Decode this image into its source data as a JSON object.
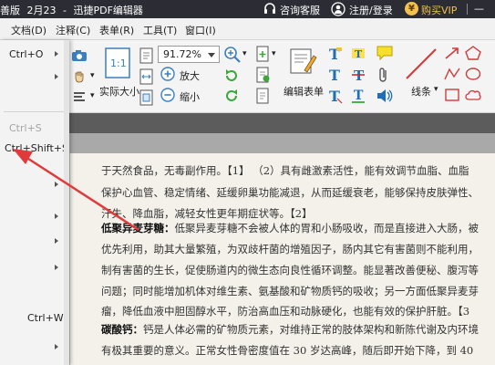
{
  "window": {
    "title_prefix": "善版",
    "date": "2月23",
    "app_name": "迅捷PDF编辑器",
    "support": "咨询客服",
    "login": "注册/登录",
    "vip": "购买VIP",
    "vip_icon": "¥",
    "minimize": "—"
  },
  "menubar": [
    "文档(D)",
    "注释(C)",
    "表单(R)",
    "工具(T)",
    "窗口(I)"
  ],
  "dropdown": {
    "items": [
      {
        "label": "Ctrl+O",
        "arrow": true,
        "disabled": false
      },
      {
        "label": "",
        "arrow": true,
        "disabled": false
      },
      {
        "label": "Ctrl+S",
        "arrow": false,
        "disabled": true
      },
      {
        "label": "Ctrl+Shift+S",
        "arrow": false,
        "disabled": false
      },
      {
        "label": "Ctrl+W",
        "arrow": false,
        "disabled": false
      }
    ]
  },
  "ribbon": {
    "zoom_value": "91.72%",
    "actual_size": "实际大小",
    "zoom_in": "放大",
    "zoom_out": "缩小",
    "edit_form": "编辑表单",
    "lines": "线条"
  },
  "document": {
    "lines": [
      {
        "bold": "",
        "text": "于天然食品，无毒副作用。【1】  （2）具有雌激素活性，能有效调节血脂、血脂"
      },
      {
        "bold": "",
        "text": "保护心血管、稳定情绪、延缓卵巢功能减退，从而延缓衰老，能够保持皮肤弹性、"
      },
      {
        "bold": "",
        "text": "汗失、降血脂，减轻女性更年期症状等。【2】"
      },
      {
        "bold": "低聚异麦芽糖：",
        "text": "低聚异麦芽糖不会被人体的胃和小肠吸收，而是直接进入大肠，被"
      },
      {
        "bold": "",
        "text": "优先利用，助其大量繁殖，为双歧杆菌的增殖因子，肠内其它有害菌则不能利用，"
      },
      {
        "bold": "",
        "text": "制有害菌的生长，促使肠道内的微生态向良性循环调整。能显著改善便秘、腹泻等"
      },
      {
        "bold": "",
        "text": "问题；同时能增加机体对维生素、氨基酸和矿物质钙的吸收；另一方面低聚异麦芽"
      },
      {
        "bold": "",
        "text": "瘤，降低血液中胆固醇水平，防治高血压和动脉硬化，也能有效的保护肝脏。【3"
      },
      {
        "bold": "碳酸钙：",
        "text": "钙是人体必需的矿物质元素，对维持正常的肢体架构和新陈代谢及内环境"
      },
      {
        "bold": "",
        "text": "有极其重要的意义。正常女性骨密度值在 30 岁达高峰，随后即开始下降，到 40"
      }
    ]
  },
  "colors": {
    "titlebar": "#2c2c34",
    "arrow": "#e03a3a",
    "vip_gold": "#f2c14e"
  }
}
